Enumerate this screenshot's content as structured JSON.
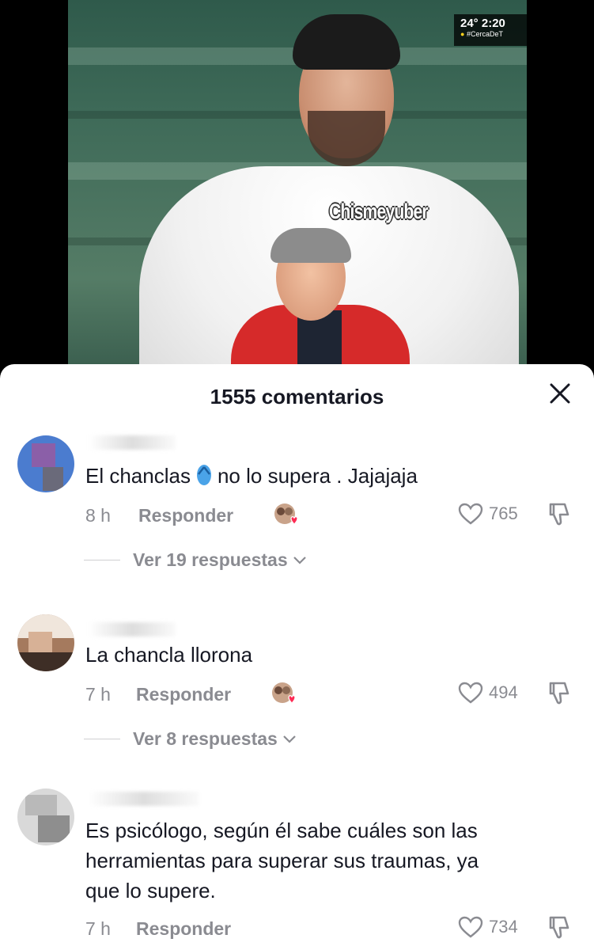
{
  "video": {
    "broadcast_time": "24° 2:20",
    "broadcast_tag": "#CercaDeT",
    "watermark": "Chismeyuber"
  },
  "sheet": {
    "title": "1555 comentarios",
    "close_icon": "close-icon"
  },
  "comments": [
    {
      "text_before": "El chanclas",
      "emoji": "flip-flop-icon",
      "text_after": "no lo supera . Jajajaja",
      "time": "8 h",
      "reply_label": "Responder",
      "likes": "765",
      "replies_label": "Ver 19 respuestas"
    },
    {
      "text": "La chancla llorona",
      "time": "7 h",
      "reply_label": "Responder",
      "likes": "494",
      "replies_label": "Ver 8 respuestas"
    },
    {
      "text_line1": "Es psicólogo, según él sabe cuáles son las",
      "text_line2": "herramientas para superar sus traumas, ya",
      "text_line3": "que lo supere.",
      "time": "7 h",
      "reply_label": "Responder",
      "likes": "734"
    }
  ],
  "colors": {
    "text_primary": "#161823",
    "text_secondary": "#8a8b91",
    "creator_heart": "#fe2c55"
  }
}
